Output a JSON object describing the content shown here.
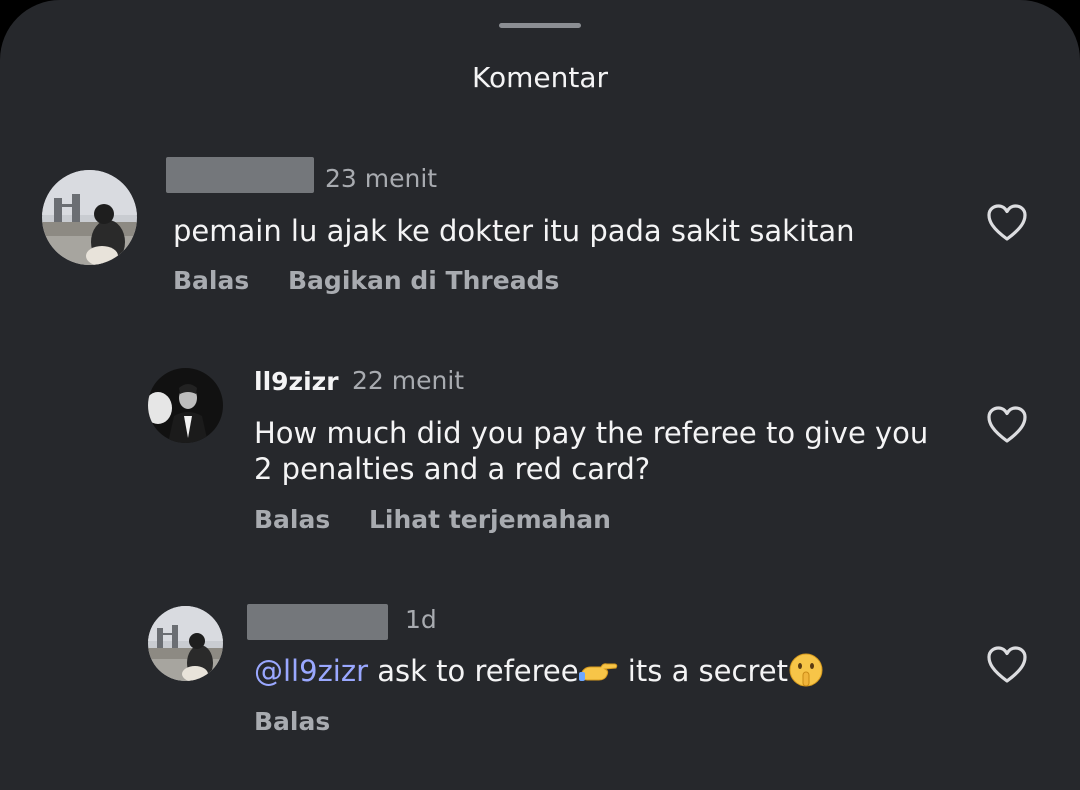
{
  "header": {
    "title": "Komentar"
  },
  "comments": [
    {
      "time": "23 menit",
      "text": "pemain lu ajak ke dokter itu pada sakit sakitan",
      "actions": [
        "Balas",
        "Bagikan di Threads"
      ]
    },
    {
      "username": "ll9zizr",
      "time": "22 menit",
      "text": "How much did you pay the referee to give you 2 penalties and a red card?",
      "actions": [
        "Balas",
        "Lihat terjemahan"
      ]
    },
    {
      "time": "1d",
      "mention": "@ll9zizr",
      "text": " ask to referee",
      "text_2": " its a secret",
      "actions": [
        "Balas"
      ]
    }
  ],
  "icons": {
    "like": "heart-outline-icon",
    "emoji_1": "backhand-pointing-right-emoji",
    "emoji_2": "shushing-face-emoji"
  },
  "colors": {
    "background": "#26282c",
    "text": "#f4f4f5",
    "secondary": "#a8abb0",
    "mention": "#9aa8ff"
  }
}
